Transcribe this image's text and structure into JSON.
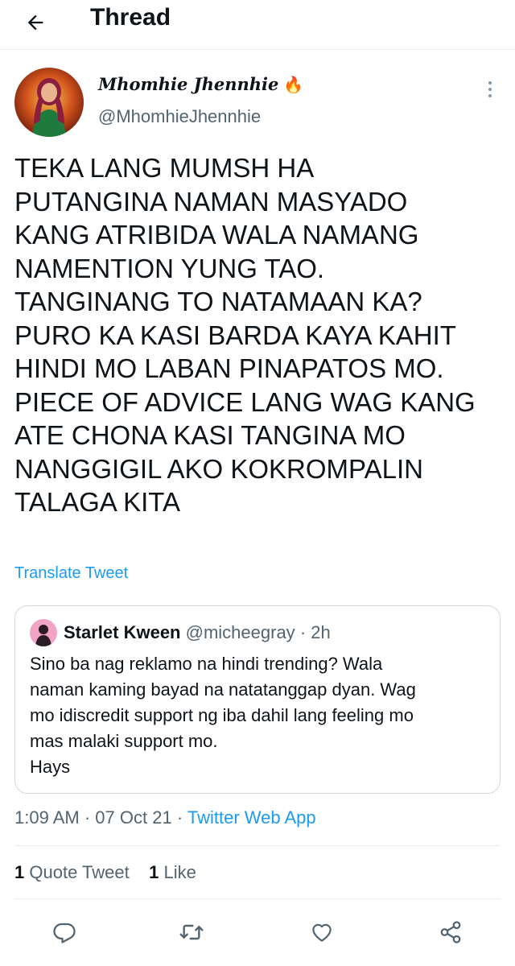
{
  "header": {
    "title": "Thread",
    "back_icon": "arrow-left-icon"
  },
  "tweet": {
    "display_name": "Mhomhie Jhennhie",
    "name_emoji": "🔥",
    "handle": "@MhomhieJhennhie",
    "text": "TEKA LANG MUMSH HA\nPUTANGINA NAMAN MASYADO\nKANG ATRIBIDA WALA NAMANG\nNAMENTION YUNG TAO.\nTANGINANG TO NATAMAAN KA?\nPURO KA KASI BARDA KAYA KAHIT\nHINDI MO LABAN PINAPATOS MO.\nPIECE OF ADVICE LANG WAG KANG\nATE CHONA KASI TANGINA MO\nNANGGIGIL AKO KOKROMPALIN\nTALAGA KITA",
    "translate_label": "Translate Tweet",
    "time": "1:09 AM",
    "date": "07 Oct 21",
    "separator": "·",
    "source_app": "Twitter Web App"
  },
  "quote": {
    "display_name": "Starlet Kween",
    "handle": "@micheegray",
    "separator": "·",
    "age": "2h",
    "text": "Sino ba nag reklamo na hindi trending? Wala\nnaman kaming bayad na natatanggap dyan. Wag\nmo idiscredit support ng iba dahil lang feeling mo\nmas malaki support mo.\nHays"
  },
  "stats": {
    "quote_count": "1",
    "quote_label": "Quote Tweet",
    "like_count": "1",
    "like_label": "Like"
  },
  "actions": [
    "reply-icon",
    "retweet-icon",
    "like-icon",
    "share-icon"
  ],
  "colors": {
    "link": "#1d9bf0",
    "secondary_text": "#536471",
    "border": "#cfd9de"
  }
}
